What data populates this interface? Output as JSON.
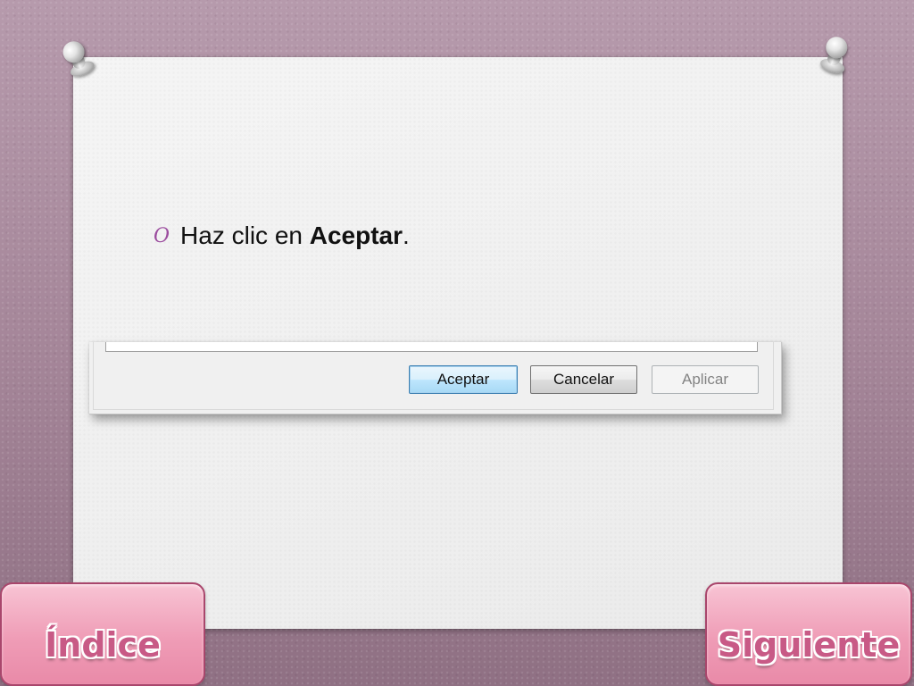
{
  "slide": {
    "bullet": {
      "marker": "O",
      "text_before": "Haz clic en ",
      "text_bold": "Aceptar",
      "text_after": "."
    }
  },
  "dialog": {
    "buttons": {
      "ok_label": "Aceptar",
      "cancel_label": "Cancelar",
      "apply_label": "Aplicar"
    }
  },
  "navigation": {
    "index_label": "Índice",
    "next_label": "Siguiente"
  },
  "colors": {
    "background": "#a88b9e",
    "bullet_marker": "#9b4c9e",
    "nav_button_fill": "#ef9cb6",
    "nav_text": "#c85a86",
    "default_button_border": "#3c7fb1"
  },
  "icons": {
    "left_pin": "pushpin-icon",
    "right_pin": "pushpin-icon"
  }
}
